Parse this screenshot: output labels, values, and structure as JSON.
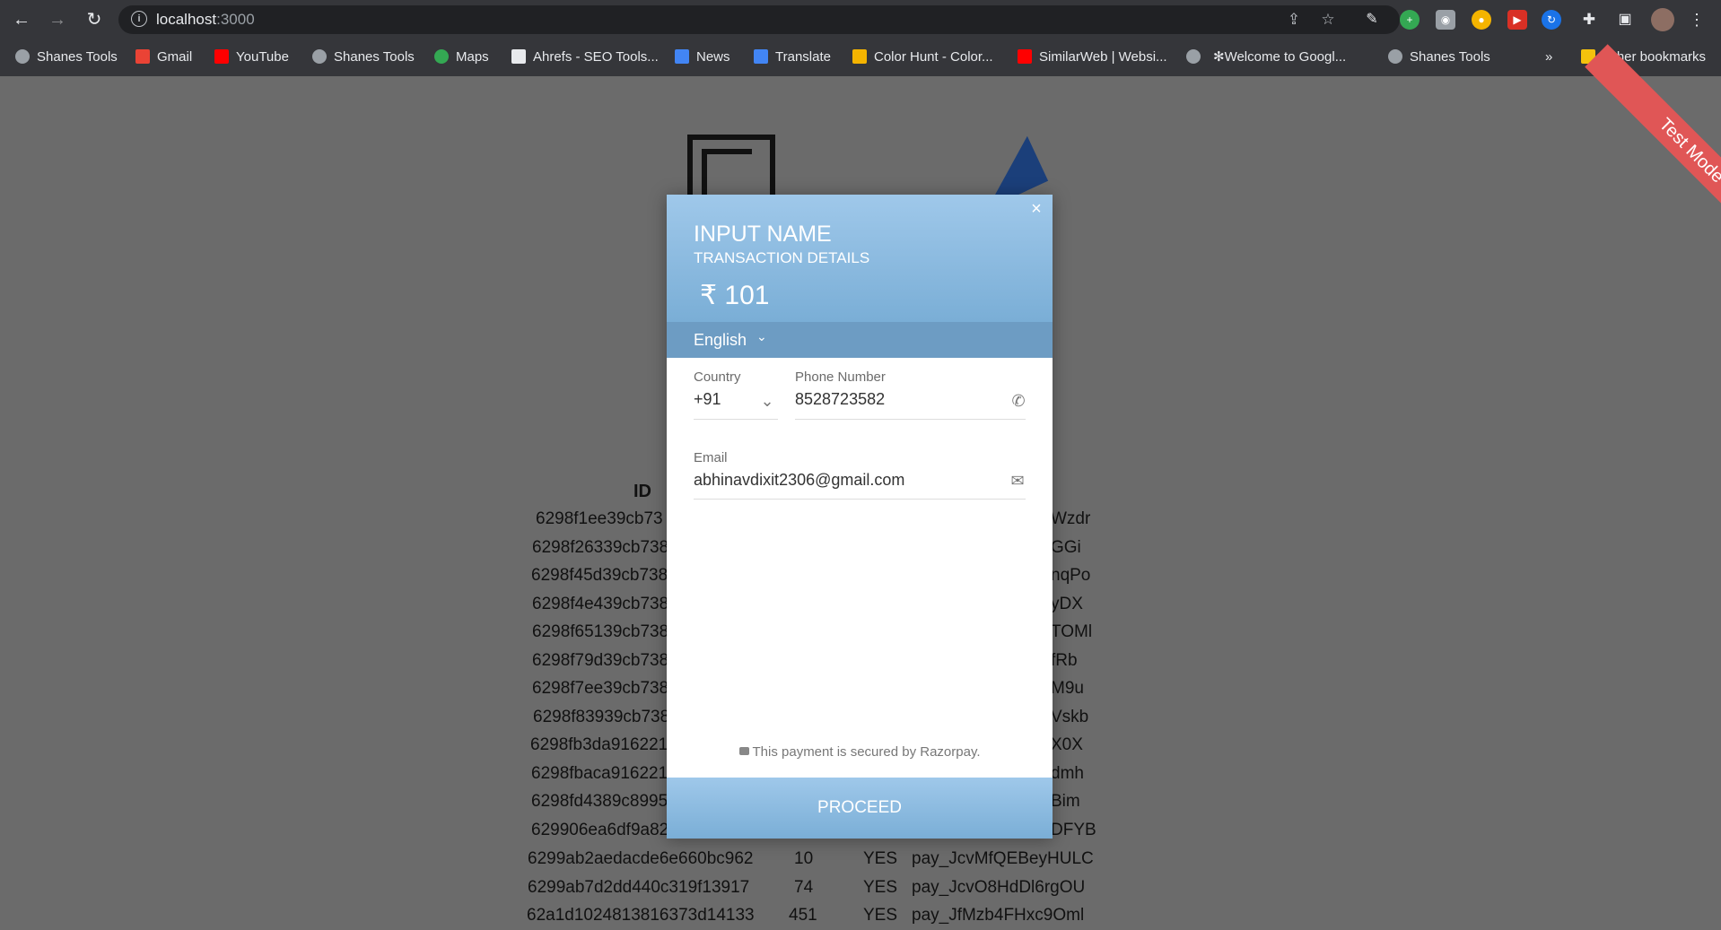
{
  "browser": {
    "url_host": "localhost",
    "url_port": ":3000",
    "bookmarks": [
      {
        "label": "Shanes Tools"
      },
      {
        "label": "Gmail"
      },
      {
        "label": "YouTube"
      },
      {
        "label": "Shanes Tools"
      },
      {
        "label": "Maps"
      },
      {
        "label": "Ahrefs - SEO Tools..."
      },
      {
        "label": "News"
      },
      {
        "label": "Translate"
      },
      {
        "label": "Color Hunt - Color..."
      },
      {
        "label": "SimilarWeb | Websi..."
      },
      {
        "label": "Welcome to Googl..."
      },
      {
        "label": "Shanes Tools"
      }
    ],
    "more_label": "»",
    "other_bookmarks": "Other bookmarks"
  },
  "page": {
    "table_header_id": "ID",
    "rows": [
      {
        "id": "6298f1ee39cb73",
        "tail": "Wzdr"
      },
      {
        "id": "6298f26339cb738",
        "tail": "GGi"
      },
      {
        "id": "6298f45d39cb738",
        "tail": "nqPo"
      },
      {
        "id": "6298f4e439cb738",
        "tail": "yDX"
      },
      {
        "id": "6298f65139cb738",
        "tail": "TOMl"
      },
      {
        "id": "6298f79d39cb738",
        "tail": "fRb"
      },
      {
        "id": "6298f7ee39cb738",
        "tail": "M9u"
      },
      {
        "id": "6298f83939cb738",
        "tail": "Vskb"
      },
      {
        "id": "6298fb3da916221",
        "tail": "X0X"
      },
      {
        "id": "6298fbaca916221",
        "tail": "dmh"
      },
      {
        "id": "6298fd4389c8995",
        "tail": "Bim"
      },
      {
        "id": "629906ea6df9a82",
        "tail": "DFYB"
      }
    ],
    "full_rows": [
      {
        "id": "6299ab2aedacde6e660bc962",
        "amount": "10",
        "status": "YES",
        "payment": "pay_JcvMfQEBeyHULC"
      },
      {
        "id": "6299ab7d2dd440c319f13917",
        "amount": "74",
        "status": "YES",
        "payment": "pay_JcvO8HdDl6rgOU"
      },
      {
        "id": "62a1d1024813816373d14133",
        "amount": "451",
        "status": "YES",
        "payment": "pay_JfMzb4FHxc9Oml"
      }
    ],
    "ribbon_text": "Test Mode"
  },
  "modal": {
    "title": "INPUT NAME",
    "subtitle": "TRANSACTION DETAILS",
    "amount": "₹ 101",
    "language": "English",
    "country_label": "Country",
    "country_value": "+91",
    "phone_label": "Phone Number",
    "phone_value": "8528723582",
    "email_label": "Email",
    "email_value": "abhinavdixit2306@gmail.com",
    "secure_text": "This payment is secured by Razorpay.",
    "proceed_label": "PROCEED",
    "close_label": "×"
  }
}
